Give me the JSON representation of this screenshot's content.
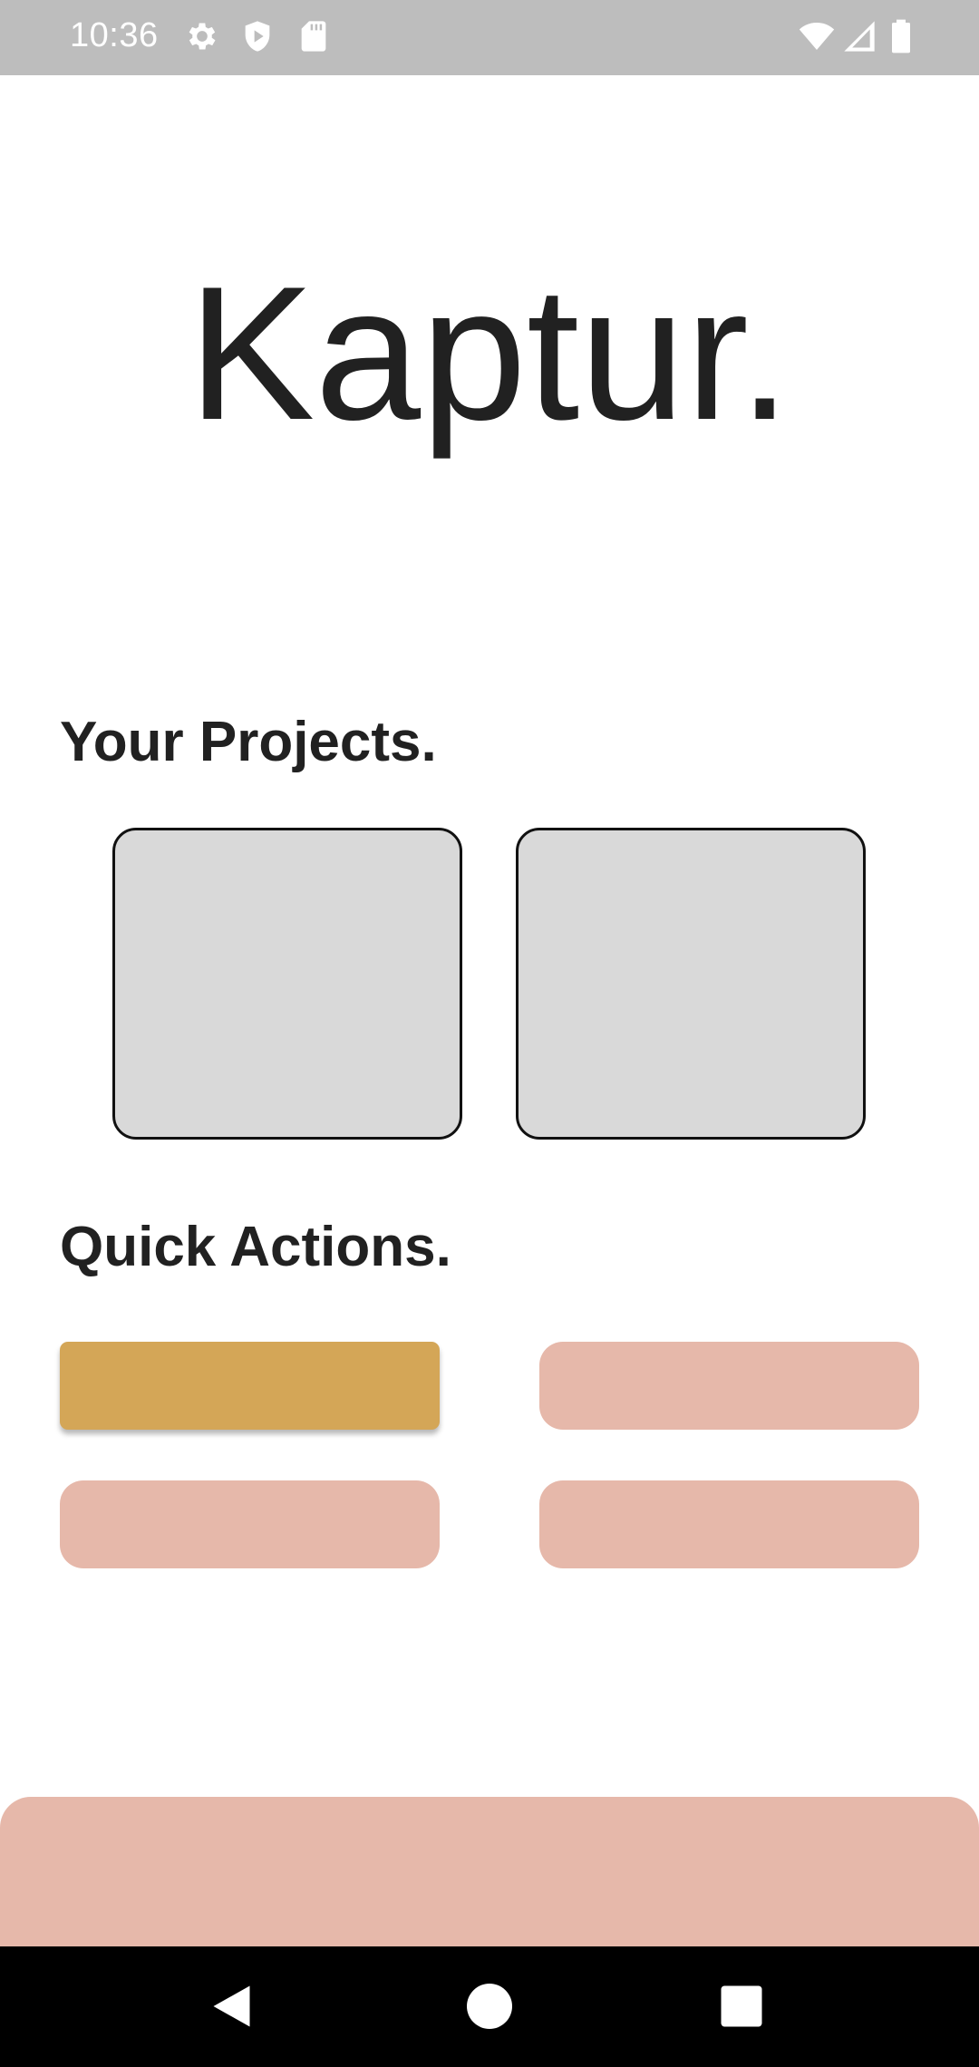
{
  "status_bar": {
    "time": "10:36",
    "left_icons": [
      "gear-icon",
      "shield-play-icon",
      "sd-card-icon"
    ],
    "right_icons": [
      "wifi-icon",
      "signal-icon",
      "battery-icon"
    ],
    "background": "#bdbdbd"
  },
  "header": {
    "title": "Kaptur."
  },
  "projects": {
    "heading": "Your Projects.",
    "card_color": "#d9d9d9"
  },
  "quick_actions": {
    "heading": "Quick Actions.",
    "primary_color": "#d4a657",
    "secondary_color": "#e6b8aa"
  },
  "bottom_panel": {
    "color": "#e6b8aa"
  },
  "nav_bar": {
    "icons": [
      "back-icon",
      "home-icon",
      "recents-icon"
    ]
  }
}
